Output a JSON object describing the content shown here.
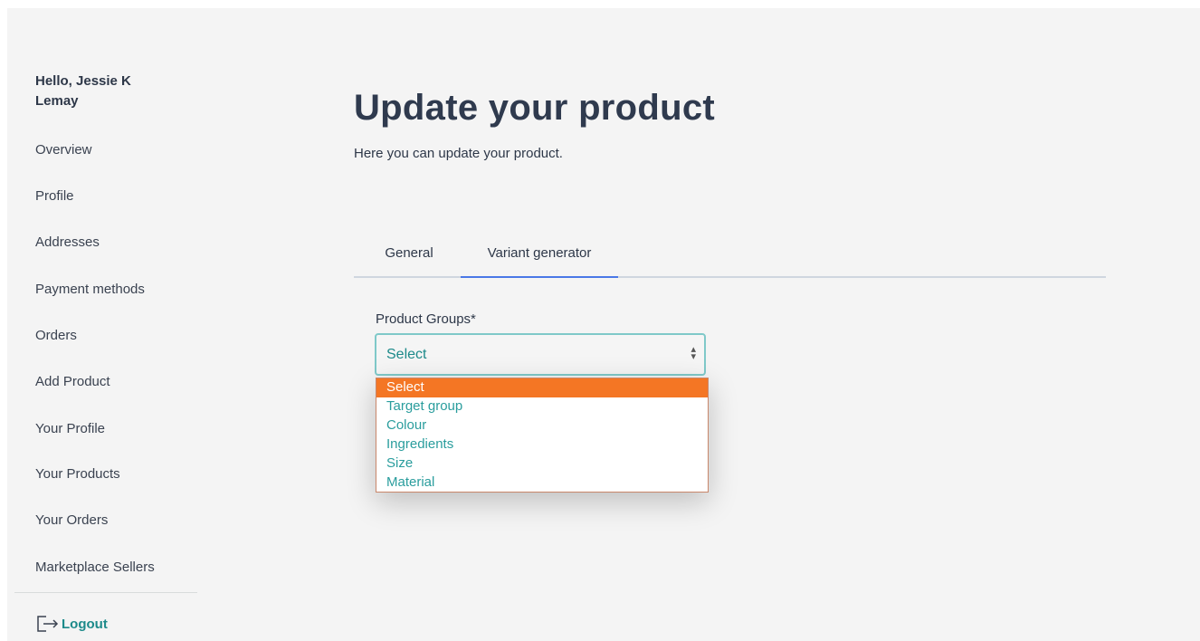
{
  "sidebar": {
    "greeting": "Hello, Jessie K Lemay",
    "items": [
      {
        "label": "Overview"
      },
      {
        "label": "Profile"
      },
      {
        "label": "Addresses"
      },
      {
        "label": "Payment methods"
      },
      {
        "label": "Orders"
      },
      {
        "label": "Add Product"
      },
      {
        "label": "Your Profile"
      },
      {
        "label": "Your Products"
      },
      {
        "label": "Your Orders"
      },
      {
        "label": "Marketplace Sellers"
      }
    ],
    "logout_label": "Logout",
    "logout_icon": "logout-icon"
  },
  "main": {
    "title": "Update your product",
    "subtitle": "Here you can update your product.",
    "tabs": [
      {
        "label": "General",
        "active": false
      },
      {
        "label": "Variant generator",
        "active": true
      }
    ],
    "product_groups": {
      "label": "Product Groups*",
      "selected_value": "Select",
      "options": [
        "Select",
        "Target group",
        "Colour",
        "Ingredients",
        "Size",
        "Material"
      ],
      "highlighted_option": "Select"
    }
  },
  "colors": {
    "accent": "#1d8a8a",
    "option_text": "#2a9d9d",
    "highlight": "#f47624",
    "active_tab": "#4a78e6",
    "panel_bg": "#f4f4f4"
  }
}
